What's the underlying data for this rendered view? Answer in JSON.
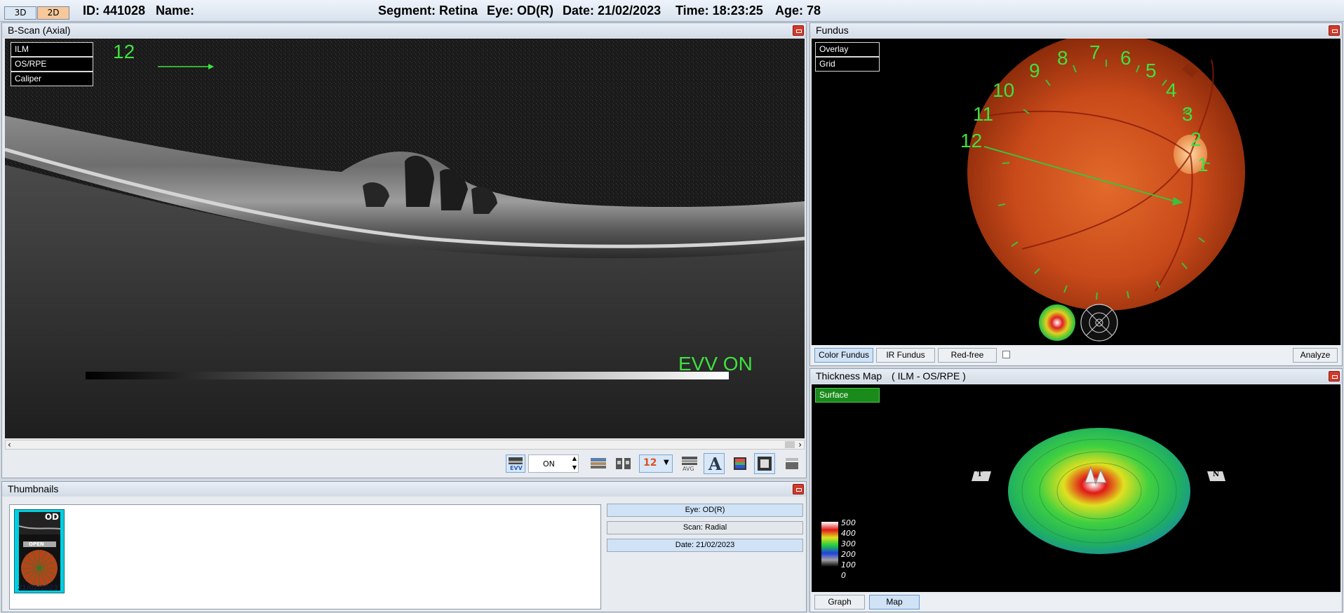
{
  "topbar": {
    "mode_3d": "3D",
    "mode_2d": "2D",
    "id_text": "ID: 441028",
    "name_text": "Name:",
    "segment_text": "Segment: Retina",
    "eye_text": "Eye: OD(R)",
    "date_text": "Date: 21/02/2023",
    "time_text": "Time: 18:23:25",
    "age_text": "Age: 78"
  },
  "bscan": {
    "title": "B-Scan (Axial)",
    "overlays": [
      "ILM",
      "OS/RPE",
      "Caliper"
    ],
    "marker_number": "12",
    "evv_label": "EVV ON",
    "toolbar": {
      "evv_label": "EVV",
      "spin_value": "ON",
      "grid_badge": "12",
      "avg_label": "AVG",
      "text_tool": "A"
    }
  },
  "thumbnails": {
    "title": "Thumbnails",
    "thumb_eye": "OD",
    "thumb_open": "OPEN",
    "thumb_date": "21/02/2023",
    "eye_row": "Eye: OD(R)",
    "scan_row": "Scan: Radial",
    "date_row": "Date: 21/02/2023"
  },
  "fundus": {
    "title": "Fundus",
    "overlay_btn": "Overlay",
    "grid_btn": "Grid",
    "clock_numbers": [
      "1",
      "2",
      "3",
      "4",
      "5",
      "6",
      "7",
      "8",
      "9",
      "10",
      "11",
      "12"
    ],
    "tabs": [
      "Color Fundus",
      "IR Fundus",
      "Red-free"
    ],
    "analyze": "Analyze"
  },
  "thickness": {
    "title": "Thickness Map",
    "subtitle": "( ILM - OS/RPE )",
    "surface_btn": "Surface",
    "left_marker": "T",
    "right_marker": "N",
    "scale": [
      "500",
      "400",
      "300",
      "200",
      "100",
      "0"
    ],
    "tabs": [
      "Graph",
      "Map"
    ]
  },
  "colors": {
    "accent_green": "#3ee13e",
    "active_tab": "#cfe2f6",
    "close_red": "#d23a2a"
  }
}
